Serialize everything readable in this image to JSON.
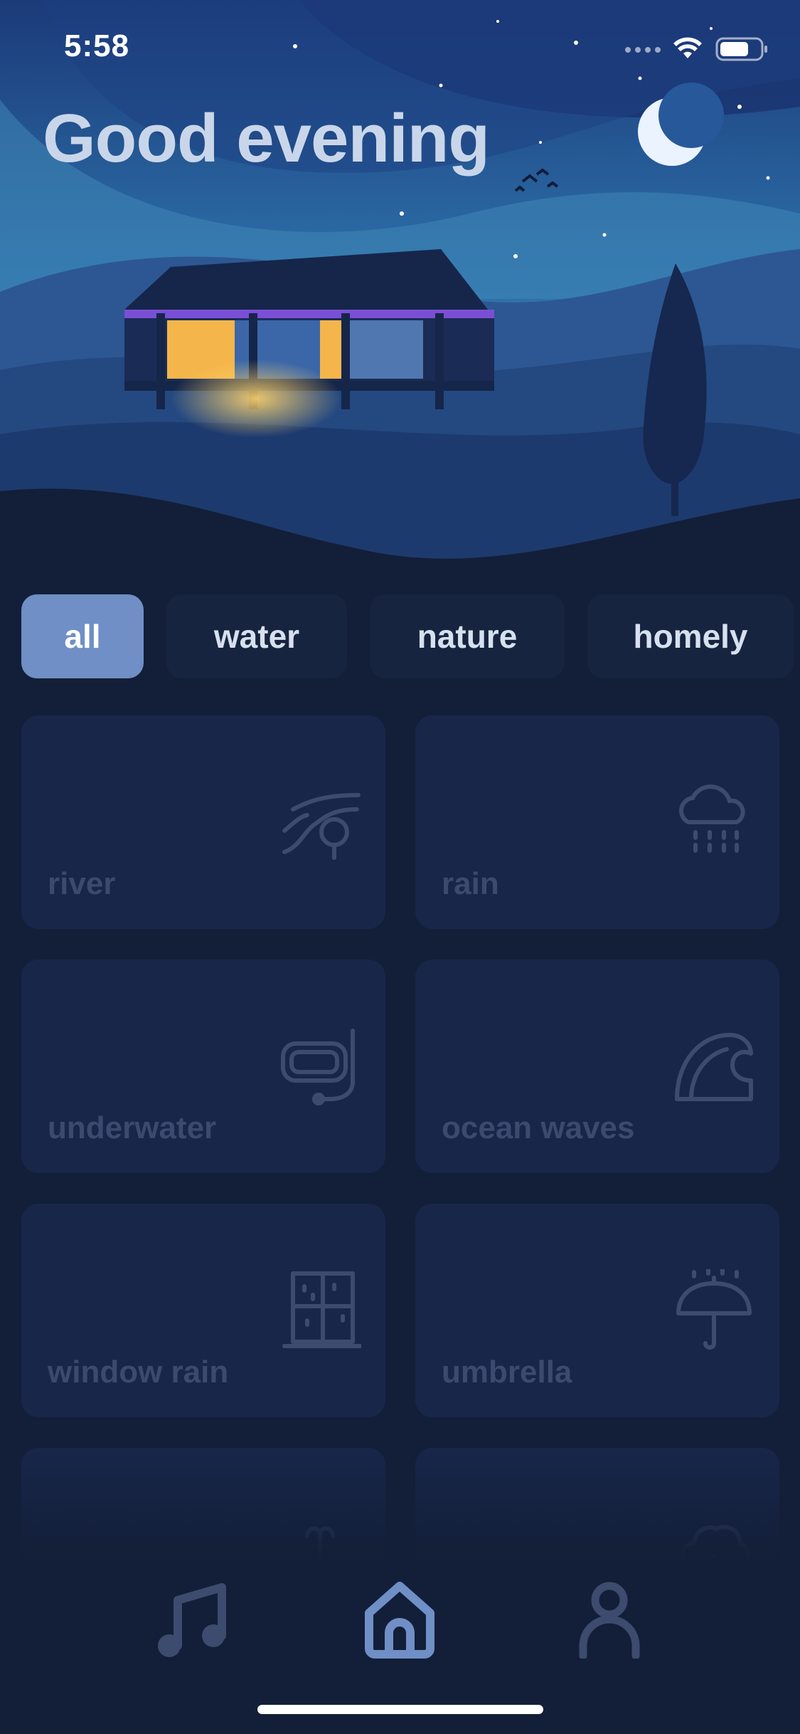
{
  "status_bar": {
    "time": "5:58",
    "battery_level": 0.72
  },
  "greeting": "Good evening",
  "filters": [
    {
      "label": "all",
      "active": true
    },
    {
      "label": "water",
      "active": false
    },
    {
      "label": "nature",
      "active": false
    },
    {
      "label": "homely",
      "active": false
    }
  ],
  "sounds": [
    {
      "label": "river",
      "icon": "river-icon"
    },
    {
      "label": "rain",
      "icon": "rain-cloud-icon"
    },
    {
      "label": "underwater",
      "icon": "snorkel-mask-icon"
    },
    {
      "label": "ocean waves",
      "icon": "wave-icon"
    },
    {
      "label": "window rain",
      "icon": "window-icon"
    },
    {
      "label": "umbrella",
      "icon": "umbrella-icon"
    },
    {
      "label": "",
      "icon": "fountain-icon"
    },
    {
      "label": "",
      "icon": "tree-icon"
    }
  ],
  "tabs": [
    {
      "name": "music",
      "icon": "music-note-icon",
      "active": false
    },
    {
      "name": "home",
      "icon": "home-icon",
      "active": true
    },
    {
      "name": "profile",
      "icon": "user-icon",
      "active": false
    }
  ],
  "colors": {
    "background": "#131f38",
    "card": "#18264a",
    "chip_active": "#6f8fc6",
    "chip_inactive": "#17243f",
    "tab_active": "#6f8fc6",
    "tab_inactive": "#3c4b6e"
  }
}
